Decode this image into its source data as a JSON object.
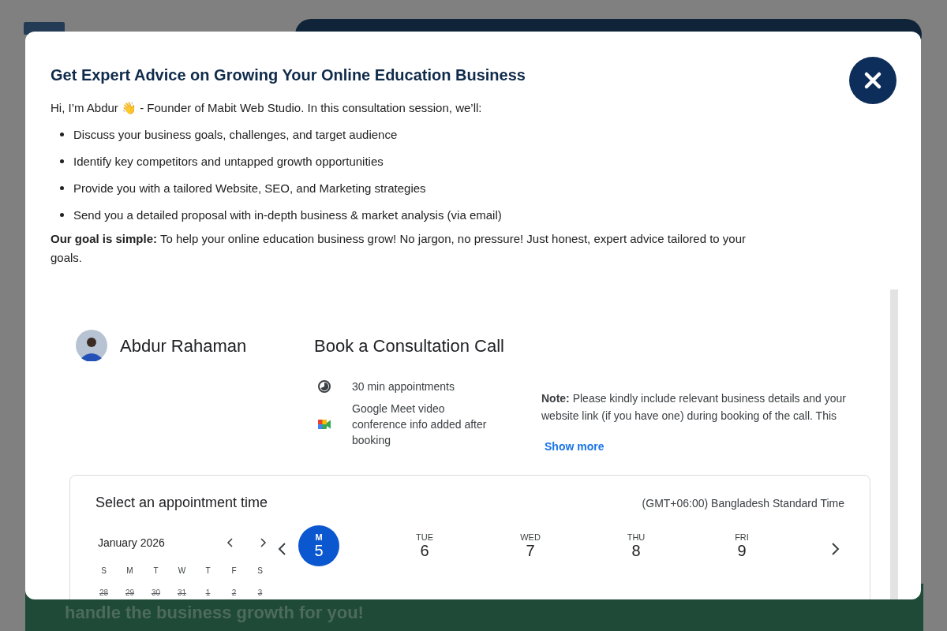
{
  "background": {
    "banner_text": "handle the business growth for you!"
  },
  "dialog": {
    "title": "Get Expert Advice on Growing Your Online Education Business",
    "intro": "Hi, I’m Abdur 👋 - Founder of Mabit Web Studio. In this consultation session, we’ll:",
    "bullets": [
      "Discuss your business goals, challenges, and target audience",
      "Identify key competitors and untapped growth opportunities",
      "Provide you with a tailored Website, SEO, and Marketing strategies",
      "Send you a detailed proposal with in-depth business & market analysis (via email)"
    ],
    "goal": "**Our goal is simple:** To help your online education business grow! No jargon, no pressure! Just honest, expert advice tailored to your goals."
  },
  "booking": {
    "host": "Abdur Rahaman",
    "title": "Book a Consultation Call",
    "details": [
      {
        "kind": "duration",
        "text": "30 min appointments"
      },
      {
        "kind": "video",
        "text": "Google Meet video conference info added after booking"
      }
    ],
    "note": "**Note:** Please kindly include relevant business details and your website link (if you have one) during booking of the call. This",
    "show_more": "Show more"
  },
  "scheduler": {
    "heading": "Select an appointment time",
    "timezone": "(GMT+06:00) Bangladesh Standard Time",
    "month": "January 2026",
    "weekdays": [
      "S",
      "M",
      "T",
      "W",
      "T",
      "F",
      "S"
    ],
    "dates": [
      {
        "day": "28",
        "disabled": true
      },
      {
        "day": "29",
        "disabled": true
      },
      {
        "day": "30",
        "disabled": true
      },
      {
        "day": "31",
        "disabled": true
      },
      {
        "day": "1",
        "disabled": true
      },
      {
        "day": "2",
        "disabled": true
      },
      {
        "day": "3",
        "disabled": true
      }
    ],
    "days": [
      {
        "weekday": "M",
        "date": "5",
        "selected": true
      },
      {
        "weekday": "TUE",
        "date": "6",
        "selected": false
      },
      {
        "weekday": "WED",
        "date": "7",
        "selected": false
      },
      {
        "weekday": "THU",
        "date": "8",
        "selected": false
      },
      {
        "weekday": "FRI",
        "date": "9",
        "selected": false
      }
    ]
  }
}
